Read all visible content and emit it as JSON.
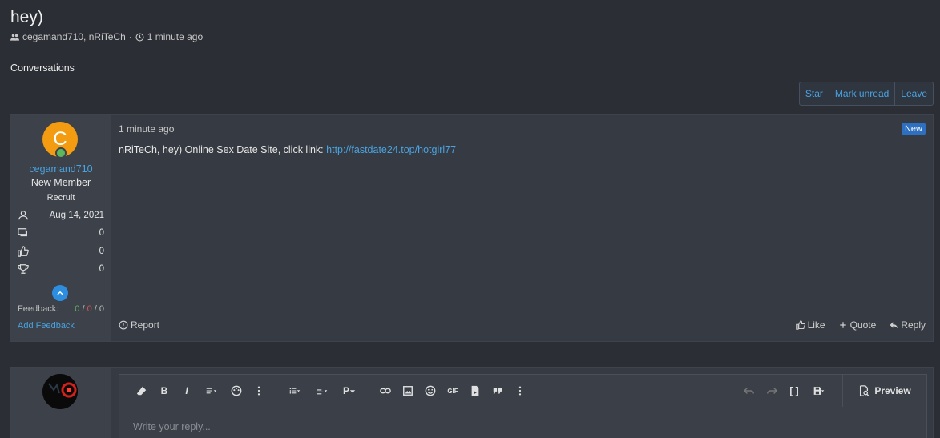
{
  "thread": {
    "title": "hey)",
    "participants": "cegamand710, nRiTeCh",
    "separator": "·",
    "time": "1 minute ago"
  },
  "section_heading": "Conversations",
  "toolbar_actions": [
    "Star",
    "Mark unread",
    "Leave"
  ],
  "message": {
    "author": {
      "avatar_letter": "C",
      "avatar_color": "#f39c12",
      "username": "cegamand710",
      "title": "New Member",
      "banner": "Recruit",
      "stats": [
        {
          "icon": "user-icon",
          "value": "Aug 14, 2021"
        },
        {
          "icon": "messages-icon",
          "value": "0"
        },
        {
          "icon": "thumbs-up-icon",
          "value": "0"
        },
        {
          "icon": "trophy-icon",
          "value": "0"
        }
      ],
      "feedback_label": "Feedback:",
      "feedback_positive": "0",
      "feedback_negative": "0",
      "feedback_neutral": "0",
      "feedback_sep": "/",
      "add_feedback": "Add Feedback"
    },
    "time": "1 minute ago",
    "badge": "New",
    "body_text": "nRiTeCh, hey) Online Sex Date Site, click link: ",
    "body_link": "http://fastdate24.top/hotgirl77",
    "report": "Report",
    "like": "Like",
    "quote": "Quote",
    "reply": "Reply"
  },
  "editor": {
    "placeholder": "Write your reply...",
    "preview_label": "Preview",
    "toolbar": {
      "bold": "B",
      "italic": "I",
      "paragraph": "P",
      "gif": "GIF",
      "code": "[ ]"
    }
  }
}
